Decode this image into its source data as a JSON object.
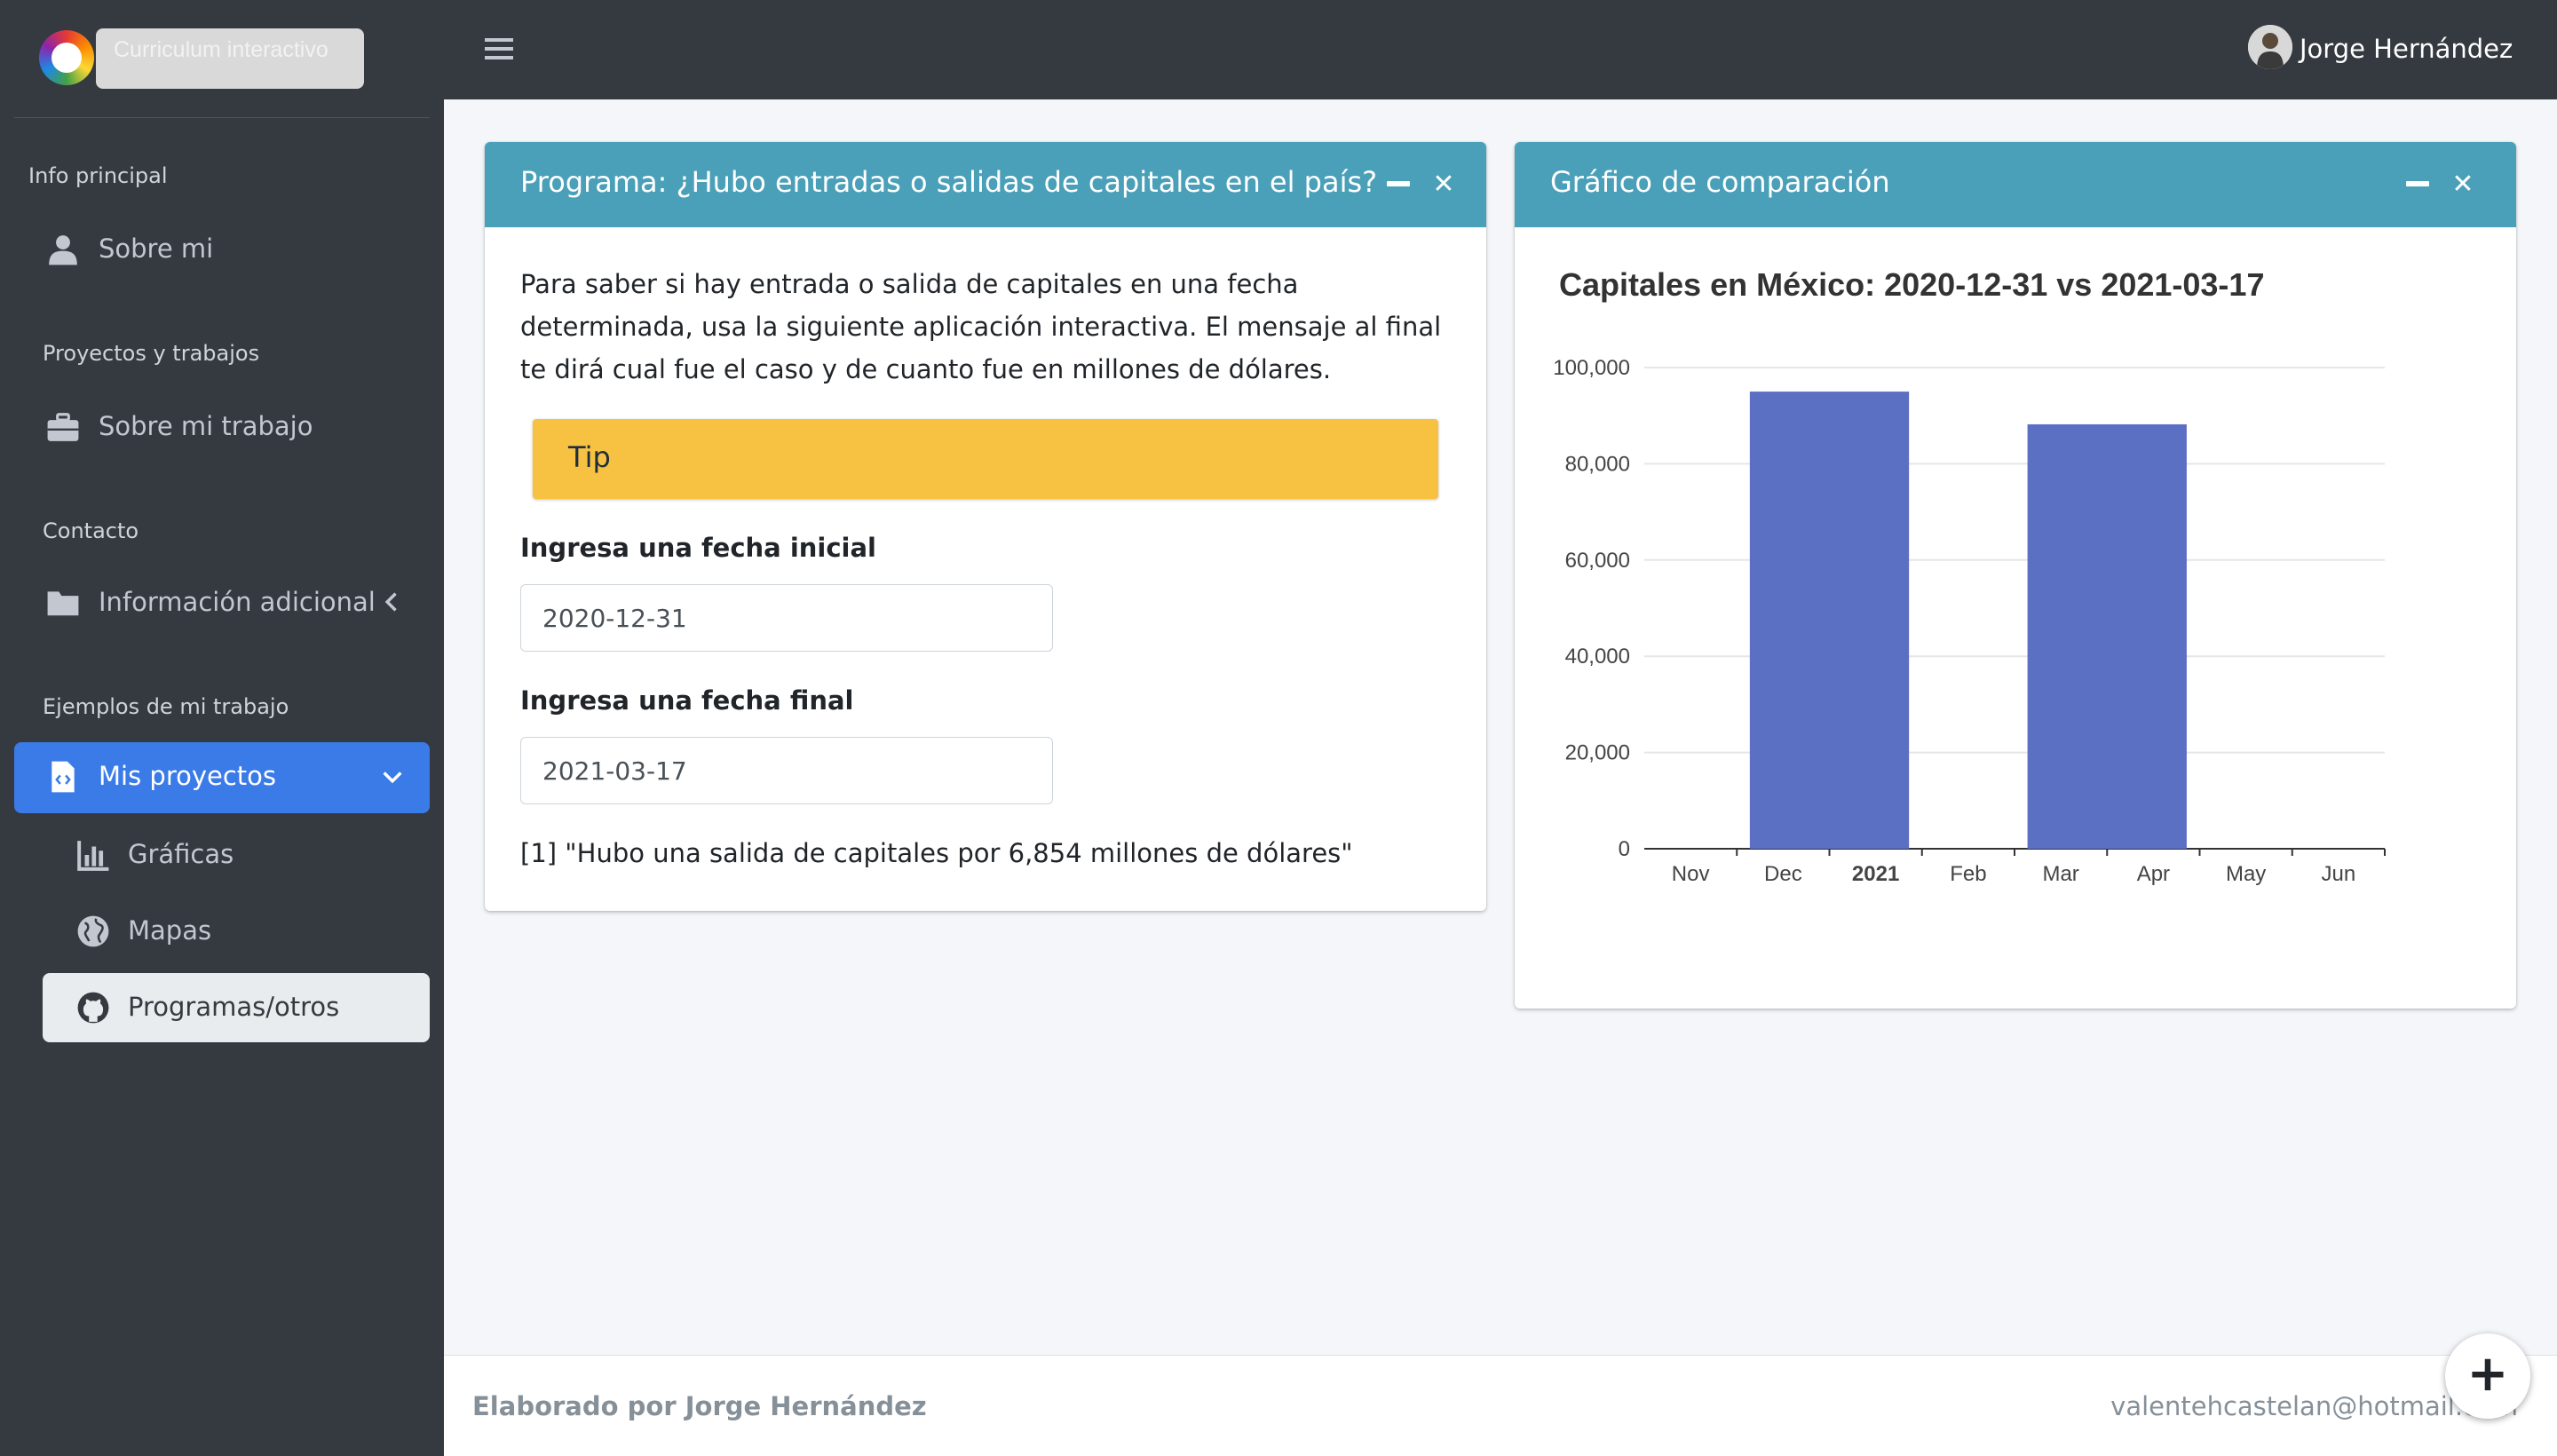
{
  "brand": {
    "text": "Curriculum interactivo"
  },
  "sidebar": {
    "sections": [
      {
        "header": "Info principal",
        "items": [
          {
            "label": "Sobre mi",
            "icon": "user-icon"
          }
        ]
      },
      {
        "header": "Proyectos y trabajos",
        "items": [
          {
            "label": "Sobre mi trabajo",
            "icon": "briefcase-icon"
          }
        ]
      },
      {
        "header": "Contacto",
        "items": [
          {
            "label": "Información adicional",
            "icon": "folder-icon"
          }
        ]
      },
      {
        "header": "Ejemplos de mi trabajo",
        "items": [
          {
            "label": "Mis proyectos",
            "icon": "file-code-icon"
          }
        ]
      }
    ],
    "subitems": [
      {
        "label": "Gráficas",
        "icon": "bar-chart-icon"
      },
      {
        "label": "Mapas",
        "icon": "globe-icon"
      },
      {
        "label": "Programas/otros",
        "icon": "github-icon"
      }
    ],
    "active_color": "#3a7be8"
  },
  "topbar": {
    "user_name": "Jorge Hernández"
  },
  "program_card": {
    "title": "Programa: ¿Hubo entradas o salidas de capitales en el país?",
    "description": "Para saber si hay entrada o salida de capitales en una fecha determinada, usa la siguiente aplicación interactiva. El mensaje al final te dirá cual fue el caso y de cuanto fue en millones de dólares.",
    "tip_label": "Tip",
    "start_label": "Ingresa una fecha inicial",
    "start_value": "2020-12-31",
    "end_label": "Ingresa una fecha final",
    "end_value": "2021-03-17",
    "result": "[1] \"Hubo una salida de capitales por 6,854 millones de dólares\""
  },
  "chart_card": {
    "title": "Gráfico de comparación"
  },
  "chart_data": {
    "type": "bar",
    "title": "Capitales en México: 2020-12-31 vs 2021-03-17",
    "xlabel": "",
    "ylabel": "",
    "x_ticks": [
      "Nov",
      "Dec",
      "2021",
      "Feb",
      "Mar",
      "Apr",
      "May",
      "Jun"
    ],
    "bold_tick": "2021",
    "categories": [
      "2020-12-31",
      "2021-03-17"
    ],
    "values": [
      95000,
      88200
    ],
    "ylim": [
      0,
      100000
    ],
    "y_ticks": [
      0,
      20000,
      40000,
      60000,
      80000,
      100000
    ],
    "y_tick_labels": [
      "0",
      "20,000",
      "40,000",
      "60,000",
      "80,000",
      "100,000"
    ],
    "bar_color": "#5b6fc3",
    "grid": true
  },
  "footer": {
    "left": "Elaborado por Jorge Hernández",
    "right": "valentehcastelan@hotmail.com"
  },
  "colors": {
    "header": "#4aa0b8",
    "tip": "#f7c242",
    "sidebar": "#343a40"
  }
}
